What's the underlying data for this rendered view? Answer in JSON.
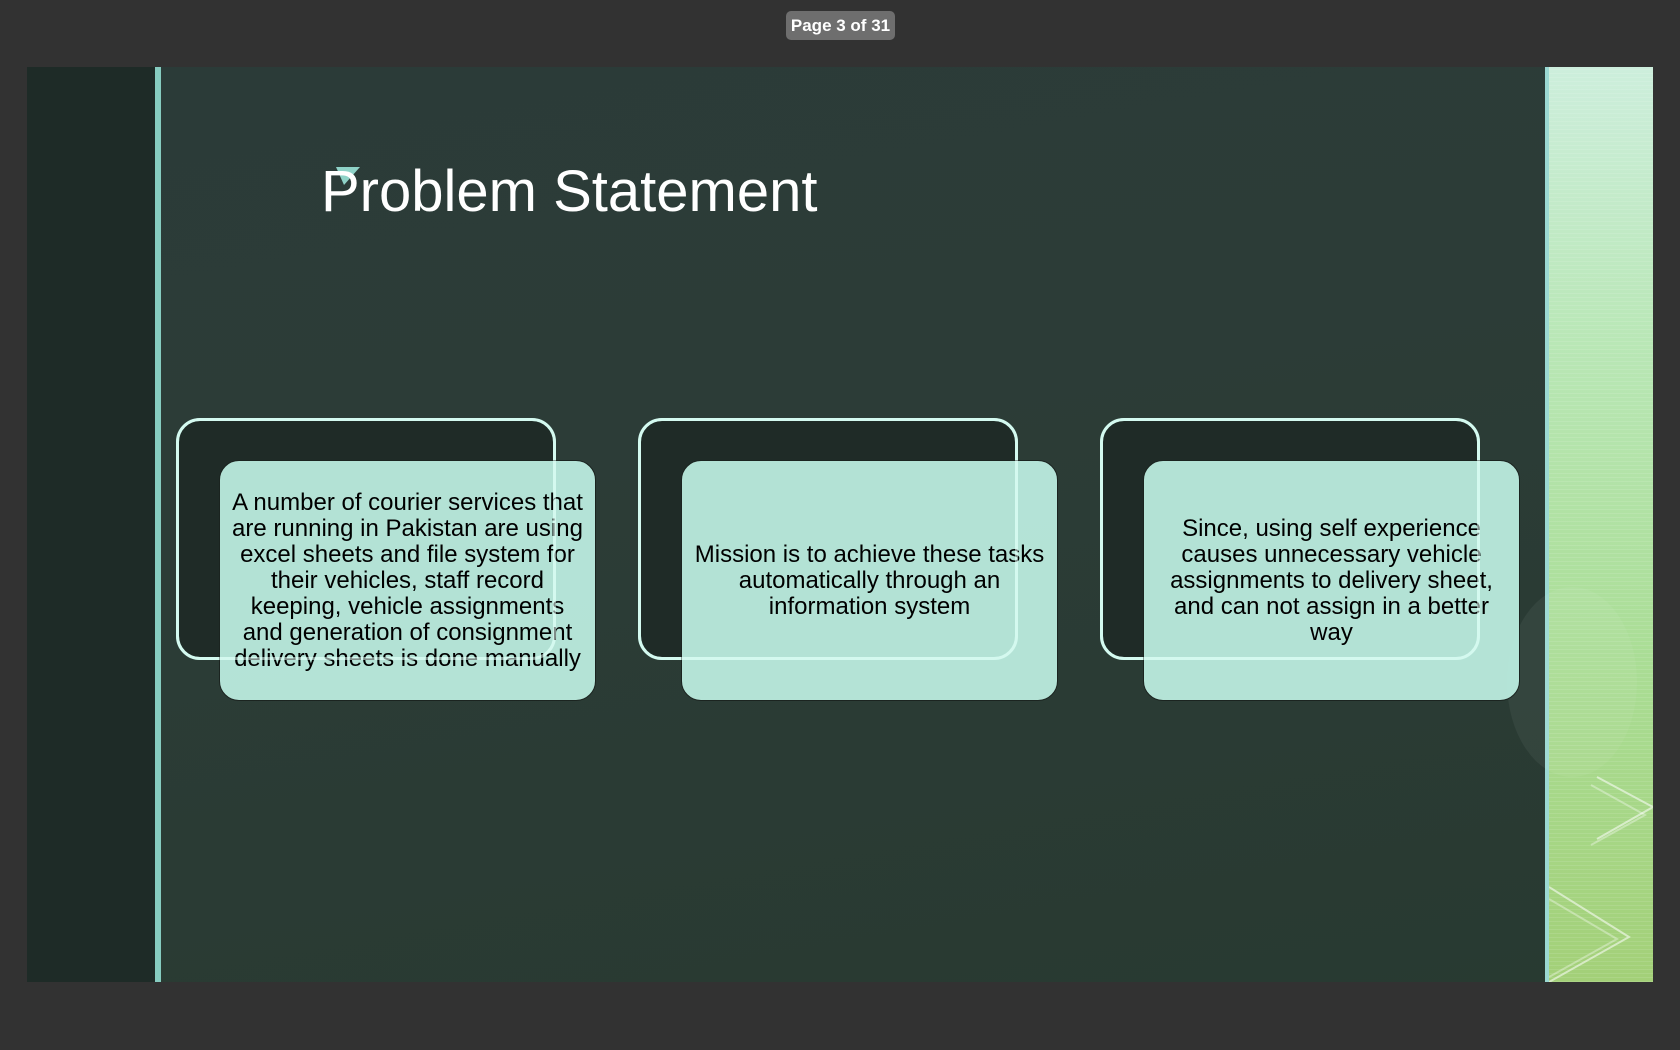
{
  "viewer": {
    "page_indicator": "Page 3 of 31"
  },
  "slide": {
    "title": "Problem Statement",
    "cards": [
      {
        "text": "A number of courier services that are running in Pakistan are using excel sheets and file system for their vehicles, staff record keeping, vehicle assignments and generation of consignment delivery sheets is done manually"
      },
      {
        "text": "Mission is to achieve these tasks automatically through an information system"
      },
      {
        "text": "Since, using self experience causes unnecessary vehicle assignments to delivery sheet, and can not assign in a better way"
      }
    ]
  },
  "colors": {
    "app_background": "#323232",
    "slide_background": "#2b3b38",
    "card_fill": "#bef0e3",
    "card_outline": "#bff3e6",
    "accent_line": "#86ccc0",
    "right_panel_green": "#aadd95"
  }
}
